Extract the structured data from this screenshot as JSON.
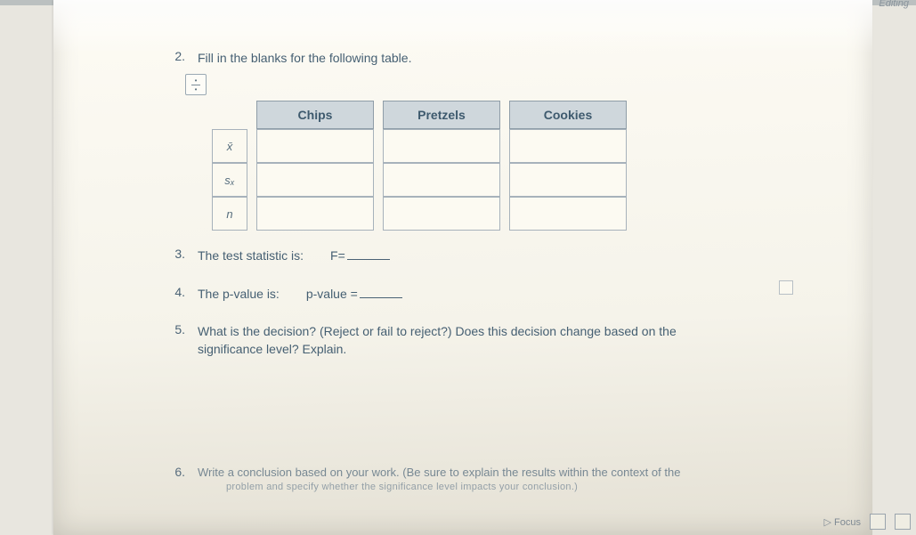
{
  "corner_label": "Editing",
  "q2": {
    "num": "2.",
    "text": "Fill in the blanks for the following table.",
    "table": {
      "headers": [
        "Chips",
        "Pretzels",
        "Cookies"
      ],
      "rows": [
        "x̄",
        "sₓ",
        "n"
      ]
    }
  },
  "q3": {
    "num": "3.",
    "label": "The test statistic is:",
    "stat": "F="
  },
  "q4": {
    "num": "4.",
    "label": "The p-value is:",
    "stat": "p-value ="
  },
  "q5": {
    "num": "5.",
    "text": "What is the decision? (Reject or fail to reject?) Does this decision change based on the significance level? Explain."
  },
  "q6": {
    "num": "6.",
    "text": "Write a conclusion based on your work. (Be sure to explain the results within the context of the",
    "sub": "problem and specify whether the significance level impacts your conclusion.)"
  },
  "footer_label": "Focus",
  "chart_data": {
    "type": "table",
    "title": "Fill in the blanks for the following table.",
    "columns": [
      "",
      "Chips",
      "Pretzels",
      "Cookies"
    ],
    "rows": [
      {
        "label": "x̄",
        "Chips": "",
        "Pretzels": "",
        "Cookies": ""
      },
      {
        "label": "sₓ",
        "Chips": "",
        "Pretzels": "",
        "Cookies": ""
      },
      {
        "label": "n",
        "Chips": "",
        "Pretzels": "",
        "Cookies": ""
      }
    ]
  }
}
